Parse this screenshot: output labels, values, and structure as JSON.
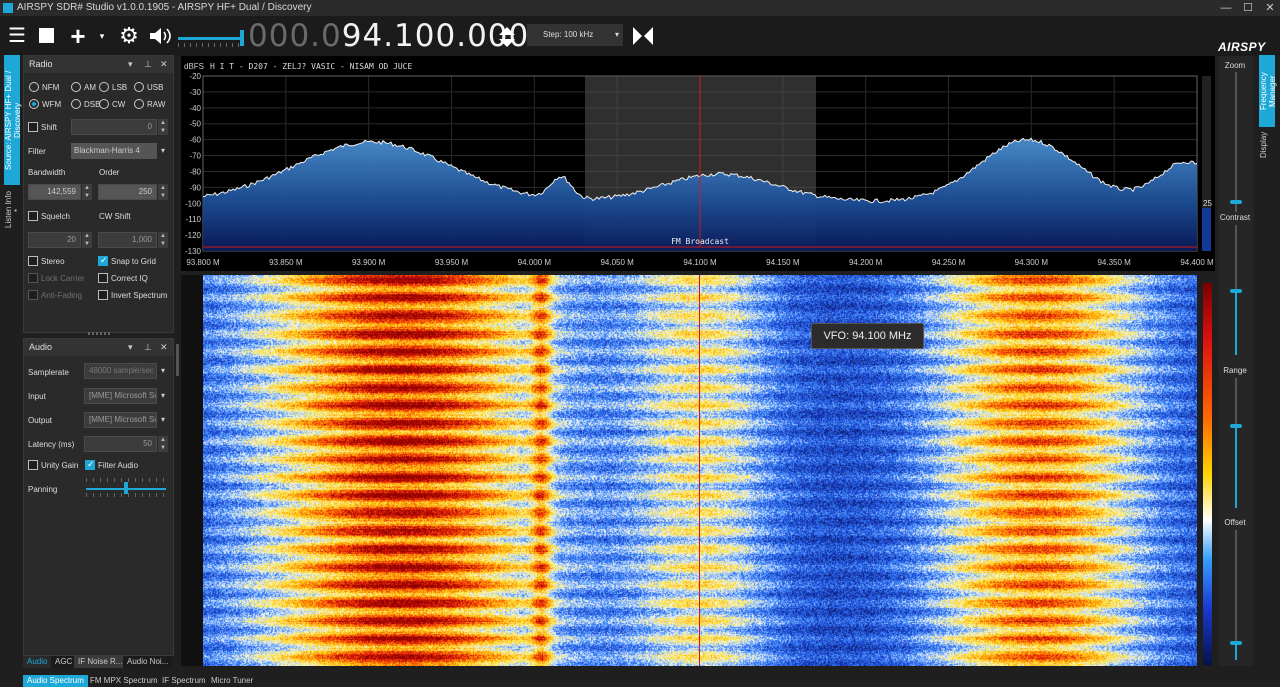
{
  "window": {
    "title": "AIRSPY SDR# Studio v1.0.0.1905 - AIRSPY HF+ Dual / Discovery",
    "minimize": "—",
    "maximize": "☐",
    "close": "✕"
  },
  "toolbar": {
    "freq_dim": "000.0",
    "freq_lit": "94.100.000",
    "step_label": "Step: 100 kHz",
    "brand": "AIRSPY"
  },
  "left_tabs": {
    "source": "Source: AIRSPY HF+ Dual / Discovery",
    "listen": "Listen Info *"
  },
  "right_tabs": {
    "freq_manager": "Frequency Manager",
    "display": "Display"
  },
  "radio_panel": {
    "title": "Radio",
    "modes": [
      "NFM",
      "AM",
      "LSB",
      "USB",
      "WFM",
      "DSB",
      "CW",
      "RAW"
    ],
    "selected_mode": "WFM",
    "shift_label": "Shift",
    "shift_value": "0",
    "filter_label": "Filter",
    "filter_value": "Blackman-Harris 4",
    "bandwidth_label": "Bandwidth",
    "bandwidth_value": "142,559",
    "order_label": "Order",
    "order_value": "250",
    "squelch_label": "Squelch",
    "squelch_value": "20",
    "cwshift_label": "CW Shift",
    "cwshift_value": "1,000",
    "stereo": "Stereo",
    "snap": "Snap to Grid",
    "lock_carrier": "Lock Carrier",
    "correct_iq": "Correct IQ",
    "anti_fading": "Anti-Fading",
    "invert": "Invert Spectrum"
  },
  "audio_panel": {
    "title": "Audio",
    "samplerate_label": "Samplerate",
    "samplerate_value": "48000 sample/sec",
    "input_label": "Input",
    "input_value": "[MME] Microsoft So",
    "output_label": "Output",
    "output_value": "[MME] Microsoft So",
    "latency_label": "Latency (ms)",
    "latency_value": "50",
    "unity": "Unity Gain",
    "filter_audio": "Filter Audio",
    "panning": "Panning"
  },
  "panel_tabs": [
    "Audio",
    "AGC",
    "IF Noise R...",
    "Audio Noi..."
  ],
  "bottom_tabs": [
    "Audio Spectrum",
    "FM MPX Spectrum",
    "IF Spectrum",
    "Micro Tuner"
  ],
  "spectrum": {
    "unit": "dBFS",
    "rds": "H I T - D207 - ZELJ? VASIC - NISAM OD JUCE",
    "y_ticks": [
      "-20",
      "-30",
      "-40",
      "-50",
      "-60",
      "-70",
      "-80",
      "-90",
      "-100",
      "-110",
      "-120",
      "-130"
    ],
    "x_ticks": [
      "93.800 M",
      "93.850 M",
      "93.900 M",
      "93.950 M",
      "94.000 M",
      "94.050 M",
      "94.100 M",
      "94.150 M",
      "94.200 M",
      "94.250 M",
      "94.300 M",
      "94.350 M",
      "94.400 M"
    ],
    "band_label": "FM Broadcast",
    "level_value": "25"
  },
  "right_panel": {
    "zoom": "Zoom",
    "contrast": "Contrast",
    "range": "Range",
    "offset": "Offset"
  },
  "vfo_tooltip": "VFO: 94.100 MHz",
  "colors": {
    "accent": "#1ea8d8",
    "vfo_line": "#d01818",
    "band_line": "#d01818"
  }
}
